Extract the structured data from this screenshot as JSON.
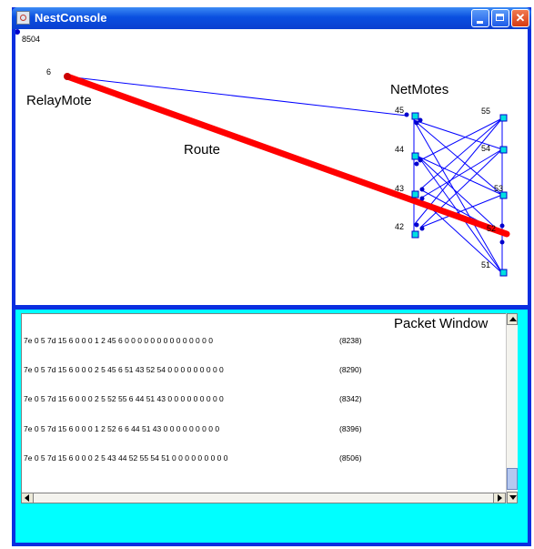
{
  "window": {
    "title": "NestConsole",
    "controls": {
      "minimize": "minimize",
      "maximize": "maximize",
      "close": "close"
    }
  },
  "network": {
    "corner_label": "8504",
    "relay_id": "6",
    "relay_label": "RelayMote",
    "route_label": "Route",
    "netmotes_label": "NetMotes",
    "mote_ids": {
      "m45": "45",
      "m44": "44",
      "m43": "43",
      "m42": "42",
      "m55": "55",
      "m54": "54",
      "m53": "53",
      "m52": "52",
      "m51": "51"
    },
    "mote_badge": "0",
    "colors": {
      "link": "#0000ff",
      "route": "#ff0000",
      "mote": "#00e0e0",
      "node": "#0000cc"
    }
  },
  "packets": {
    "window_label": "Packet Window",
    "rows": [
      {
        "data": "7e 0 5 7d 15 6 0 0 0 1 2 45 6 0 0 0 0 0 0 0 0 0 0 0 0 0 0",
        "id": "(8238)"
      },
      {
        "data": "7e 0 5 7d 15 6 0 0 0 2 5 45 6 51 43 52 54 0 0 0 0 0 0 0 0 0",
        "id": "(8290)"
      },
      {
        "data": "7e 0 5 7d 15 6 0 0 0 2 5 52 55 6 44 51 43 0 0 0 0 0 0 0 0 0",
        "id": "(8342)"
      },
      {
        "data": "7e 0 5 7d 15 6 0 0 0 1 2 52 6 6 44 51 43 0 0 0 0 0 0 0 0 0",
        "id": "(8396)"
      },
      {
        "data": "7e 0 5 7d 15 6 0 0 0 2 5 43 44 52 55 54 51 0 0 0 0 0 0 0 0 0",
        "id": "(8506)"
      }
    ]
  }
}
